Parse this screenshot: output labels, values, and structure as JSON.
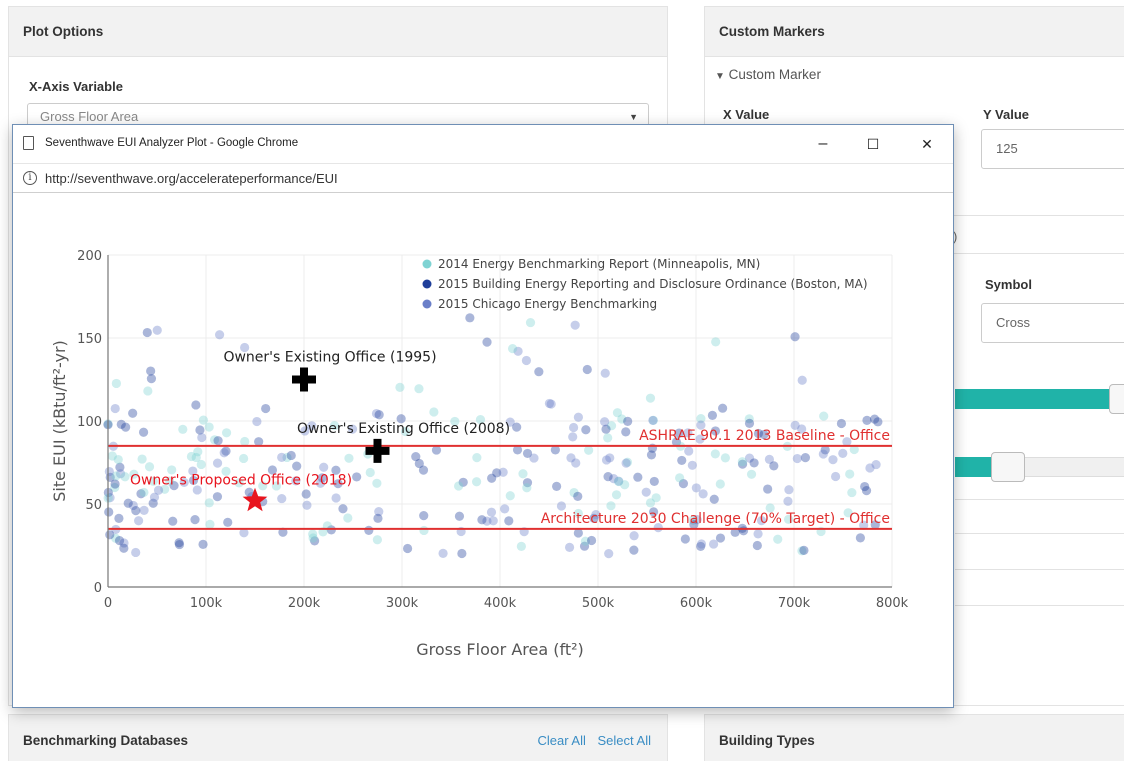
{
  "plot_options": {
    "header": "Plot Options",
    "x_axis_label": "X-Axis Variable",
    "x_axis_value": "Gross Floor Area"
  },
  "custom_markers": {
    "header": "Custom Markers",
    "section_label": "Custom Marker",
    "x_value_label": "X Value",
    "y_value_label": "Y Value",
    "y_value": "125",
    "symbol_label": "Symbol",
    "symbol_value": "Cross",
    "partial_text": ")",
    "slider_1": 0.92,
    "slider_2": 0.7
  },
  "benchmarking": {
    "header": "Benchmarking Databases",
    "clear_all": "Clear All",
    "select_all": "Select All"
  },
  "building_types": {
    "header": "Building Types"
  },
  "window": {
    "title": "Seventhwave EUI Analyzer Plot - Google Chrome",
    "url": "http://seventhwave.org/accelerateperformance/EUI",
    "minimize": "–",
    "maximize": "☐",
    "close": "✕"
  },
  "chart_data": {
    "type": "scatter",
    "xlabel": "Gross Floor Area  (ft²)",
    "ylabel": "Site EUI  (kBtu/ft²-yr)",
    "xlim": [
      0,
      800000
    ],
    "ylim": [
      0,
      200
    ],
    "x_ticks": [
      0,
      100000,
      200000,
      300000,
      400000,
      500000,
      600000,
      700000,
      800000
    ],
    "x_tick_labels": [
      "0",
      "100k",
      "200k",
      "300k",
      "400k",
      "500k",
      "600k",
      "700k",
      "800k"
    ],
    "y_ticks": [
      0,
      50,
      100,
      150,
      200
    ],
    "y_tick_labels": [
      "0",
      "50",
      "100",
      "150",
      "200"
    ],
    "legend_position": "top-right",
    "series": [
      {
        "name": "2014 Energy Benchmarking Report (Minneapolis, MN)",
        "color": "#7fd3d3"
      },
      {
        "name": "2015 Building Energy Reporting and Disclosure Ordinance (Boston, MA)",
        "color": "#1f3f9a"
      },
      {
        "name": "2015 Chicago Energy Benchmarking",
        "color": "#6a7fc8"
      }
    ],
    "reference_lines": [
      {
        "label": "ASHRAE 90.1 2013 Baseline - Office",
        "y": 85,
        "color": "#e03030"
      },
      {
        "label": "Architecture 2030 Challenge (70% Target) - Office",
        "y": 35,
        "color": "#e03030"
      }
    ],
    "markers": [
      {
        "label": "Owner's Existing Office (1995)",
        "x": 200000,
        "y": 125,
        "symbol": "cross",
        "color": "#000000"
      },
      {
        "label": "Owner's Existing Office (2008)",
        "x": 275000,
        "y": 82,
        "symbol": "cross",
        "color": "#000000"
      },
      {
        "label": "Owner's Proposed Office (2018)",
        "x": 150000,
        "y": 52,
        "symbol": "star",
        "color": "#e8141e"
      }
    ]
  }
}
